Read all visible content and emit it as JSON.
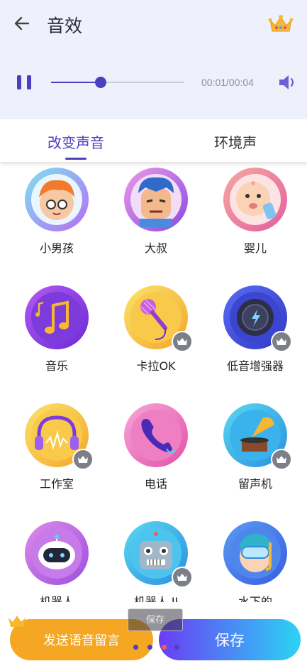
{
  "header": {
    "title": "音效"
  },
  "player": {
    "time": "00:01/00:04",
    "progress": 0.37
  },
  "tabs": [
    {
      "label": "改变声音",
      "active": true
    },
    {
      "label": "环境声",
      "active": false
    }
  ],
  "effects": [
    {
      "label": "小男孩",
      "icon": "boy-icon",
      "locked": false
    },
    {
      "label": "大叔",
      "icon": "uncle-icon",
      "locked": false
    },
    {
      "label": "婴儿",
      "icon": "baby-icon",
      "locked": false
    },
    {
      "label": "音乐",
      "icon": "music-notes-icon",
      "locked": false
    },
    {
      "label": "卡拉OK",
      "icon": "microphone-icon",
      "locked": true
    },
    {
      "label": "低音增强器",
      "icon": "bass-knob-icon",
      "locked": true
    },
    {
      "label": "工作室",
      "icon": "headphones-icon",
      "locked": true
    },
    {
      "label": "电话",
      "icon": "phone-icon",
      "locked": false
    },
    {
      "label": "留声机",
      "icon": "gramophone-icon",
      "locked": true
    },
    {
      "label": "机器人",
      "icon": "robot-icon",
      "locked": false
    },
    {
      "label": "机器人 II",
      "icon": "robot-2-icon",
      "locked": true
    },
    {
      "label": "水下的",
      "icon": "diver-icon",
      "locked": false
    }
  ],
  "buttons": {
    "send": "发送语音留言",
    "save": "保存",
    "tooltip": "保存"
  },
  "colors": {
    "accent": "#4b3fc2",
    "send": "#f5a623",
    "save_start": "#6a3cf5",
    "save_end": "#2cd4f4",
    "lock": "#7c7f88"
  }
}
